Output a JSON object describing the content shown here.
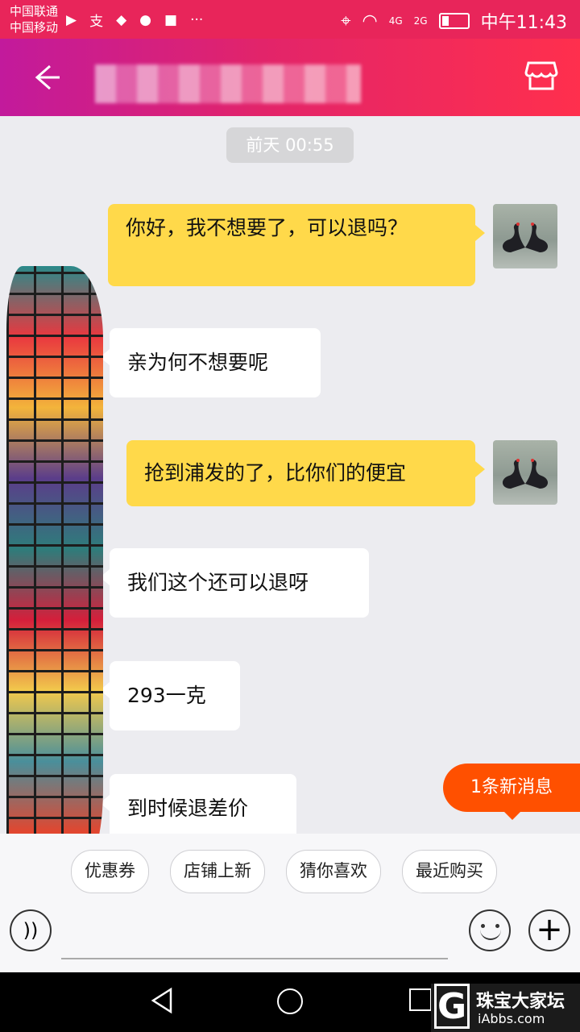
{
  "status_bar": {
    "carrier_1": "中国联通",
    "carrier_2": "中国移动",
    "icons": [
      "app-icon",
      "alipay-icon",
      "shield-app-icon",
      "bird-app-icon",
      "jd-icon",
      "more-icon"
    ],
    "signal_1": "4G",
    "signal_2": "2G",
    "time": "中午11:43"
  },
  "header": {
    "back_icon": "arrow-left-icon",
    "store_icon": "storefront-icon"
  },
  "chat": {
    "timestamp": "前天 00:55",
    "messages": [
      {
        "from": "me",
        "text": "你好，我不想要了，可以退吗？"
      },
      {
        "from": "other",
        "text": "亲为何不想要呢"
      },
      {
        "from": "me",
        "text": "抢到浦发的了，比你们的便宜"
      },
      {
        "from": "other",
        "text": "我们这个还可以退呀"
      },
      {
        "from": "other",
        "text": "293一克"
      },
      {
        "from": "other",
        "text": "到时候退差价"
      }
    ],
    "new_message_label": "1条新消息"
  },
  "quick_replies": [
    "优惠券",
    "店铺上新",
    "猜你喜欢",
    "最近购买"
  ],
  "input_bar": {
    "voice_icon": "voice-icon",
    "emoji_icon": "emoji-icon",
    "add_icon": "plus-icon"
  },
  "watermark": {
    "line_1": "珠宝大家坛",
    "line_2": "iAbbs.com"
  }
}
